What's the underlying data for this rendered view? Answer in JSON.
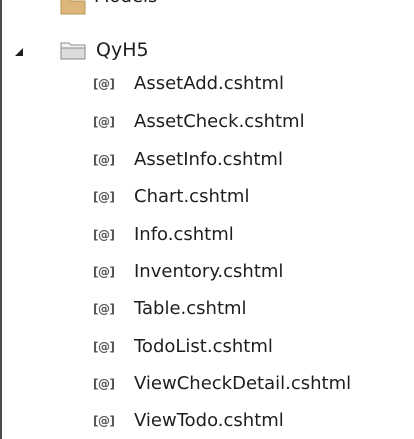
{
  "tree": {
    "partial_row": {
      "label": "Models",
      "icon": "folder-icon"
    },
    "root": {
      "label": "QyH5",
      "expanded": true,
      "expander_icon": "expanded-triangle-icon",
      "icon": "folder-icon"
    },
    "files": [
      {
        "icon_glyph": "[@]",
        "label": "AssetAdd.cshtml"
      },
      {
        "icon_glyph": "[@]",
        "label": "AssetCheck.cshtml"
      },
      {
        "icon_glyph": "[@]",
        "label": "AssetInfo.cshtml"
      },
      {
        "icon_glyph": "[@]",
        "label": "Chart.cshtml"
      },
      {
        "icon_glyph": "[@]",
        "label": "Info.cshtml"
      },
      {
        "icon_glyph": "[@]",
        "label": "Inventory.cshtml"
      },
      {
        "icon_glyph": "[@]",
        "label": "Table.cshtml"
      },
      {
        "icon_glyph": "[@]",
        "label": "TodoList.cshtml"
      },
      {
        "icon_glyph": "[@]",
        "label": "ViewCheckDetail.cshtml"
      },
      {
        "icon_glyph": "[@]",
        "label": "ViewTodo.cshtml"
      }
    ]
  },
  "colors": {
    "background": "#ffffff",
    "text": "#1e1e1e",
    "folder": "#dcb67a",
    "razor_icon": "#555555"
  }
}
